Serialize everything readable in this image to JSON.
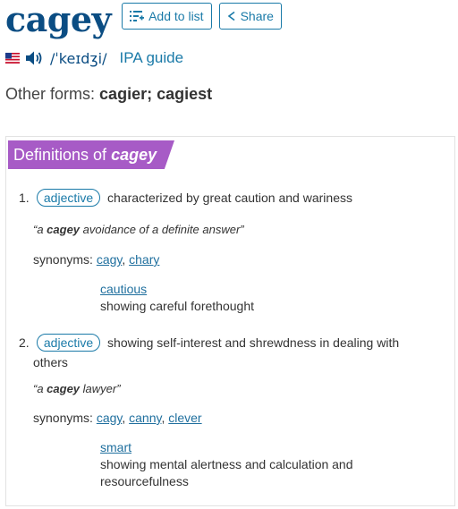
{
  "header": {
    "word": "cagey",
    "add_to_list": "Add to list",
    "share": "Share"
  },
  "pronunciation": {
    "flag": "us-flag-icon",
    "audio": "speaker-icon",
    "ipa": "/ˈkeɪdʒi/",
    "ipa_guide": "IPA guide"
  },
  "other_forms": {
    "label": "Other forms:",
    "value": "cagier; cagiest"
  },
  "definitions": {
    "title_prefix": "Definitions of",
    "title_word": "cagey",
    "senses": [
      {
        "num": "1.",
        "pos": "adjective",
        "definition": "characterized by great caution and wariness",
        "example_pre": "“a ",
        "example_word": "cagey",
        "example_post": " avoidance of a definite answer”",
        "synonyms_label": "synonyms:",
        "synonyms": [
          "cagy",
          "chary"
        ],
        "related_word": "cautious",
        "related_def": "showing careful forethought"
      },
      {
        "num": "2.",
        "pos": "adjective",
        "definition_line1": "showing self-interest and shrewdness in dealing with",
        "definition_line2": "others",
        "example_pre": "“a ",
        "example_word": "cagey",
        "example_post": " lawyer”",
        "synonyms_label": "synonyms:",
        "synonyms": [
          "cagy",
          "canny",
          "clever"
        ],
        "related_word": "smart",
        "related_def_line1": "showing mental alertness and calculation and",
        "related_def_line2": "resourcefulness"
      }
    ]
  },
  "colors": {
    "brand": "#0b4d83",
    "accent": "#1a7aa8",
    "banner": "#a75bc6"
  }
}
